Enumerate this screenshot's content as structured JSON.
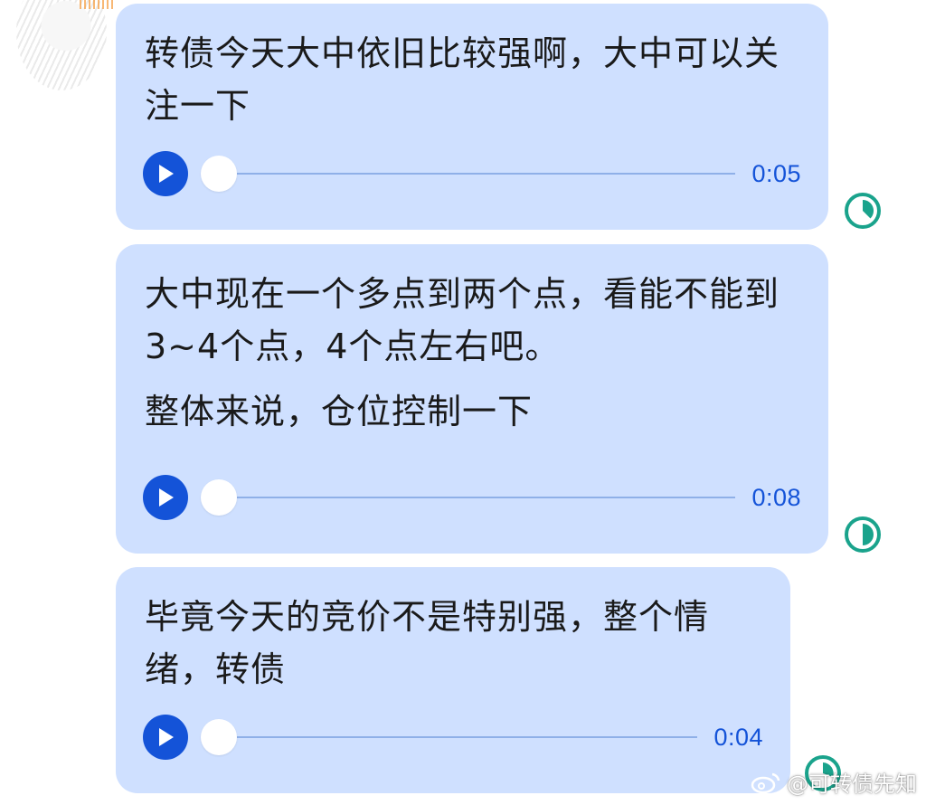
{
  "messages": [
    {
      "paragraphs": [
        "转债今天大中依旧比较强啊，大中可以关注一下"
      ],
      "duration": "0:05",
      "progress": 0
    },
    {
      "paragraphs": [
        "大中现在一个多点到两个点，看能不能到3~4个点，4个点左右吧。",
        "整体来说，仓位控制一下"
      ],
      "duration": "0:08",
      "progress": 0
    },
    {
      "paragraphs": [
        "毕竟今天的竞价不是特别强，整个情绪，转债"
      ],
      "duration": "0:04",
      "progress": 0
    }
  ],
  "icons": {
    "play": "play-icon",
    "status": "read-status-icon",
    "watermark_logo": "weibo-logo-icon"
  },
  "colors": {
    "bubble_bg": "#cfe0ff",
    "accent": "#1453d8",
    "status_green": "#1aa38c",
    "track": "#8fb0e8"
  },
  "watermark": {
    "text": "@可转债先知"
  }
}
